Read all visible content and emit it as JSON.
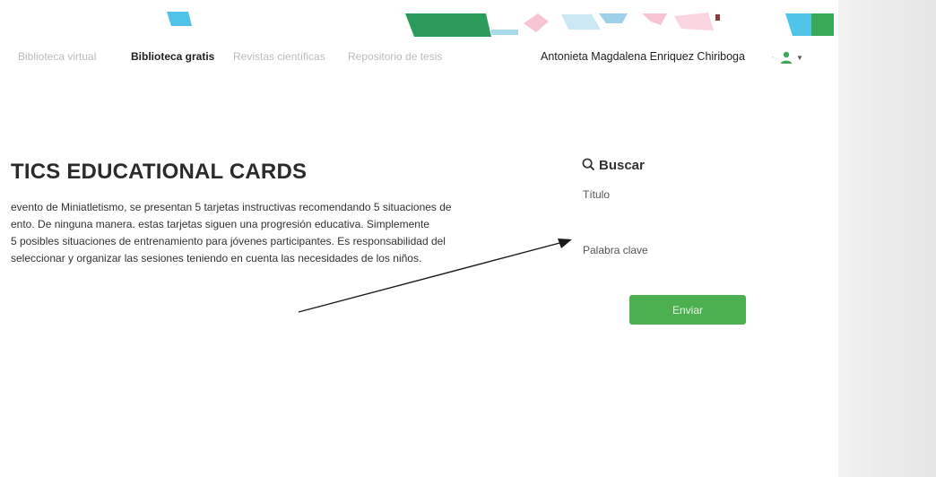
{
  "nav": {
    "items": [
      {
        "label": "Biblioteca virtual",
        "active": false
      },
      {
        "label": "Biblioteca gratis",
        "active": true
      },
      {
        "label": "Revistas científicas",
        "active": false
      },
      {
        "label": "Repositorio de tesis",
        "active": false
      }
    ],
    "user_name": "Antonieta Magdalena Enriquez Chiriboga",
    "user_icon": "user-icon",
    "caret_icon": "caret-down-icon"
  },
  "main": {
    "title": "TICS EDUCATIONAL CARDS",
    "description_lines": [
      "evento de Miniatletismo, se presentan 5 tarjetas instructivas recomendando 5 situaciones de",
      "ento. De ninguna manera. estas tarjetas siguen una progresión educativa. Simplemente",
      " 5 posibles situaciones de entrenamiento para jóvenes participantes. Es responsabilidad del",
      "seleccionar y organizar las sesiones teniendo en cuenta las necesidades de los niños."
    ]
  },
  "search": {
    "title": "Buscar",
    "icon": "search-icon",
    "fields": [
      {
        "label": "Título",
        "value": ""
      },
      {
        "label": "Palabra clave",
        "value": ""
      }
    ],
    "submit_label": "Enviar"
  },
  "colors": {
    "accent_green": "#4cb050",
    "banner_blue": "#4fc3e8",
    "banner_green": "#3aa856",
    "banner_pink": "#f4b6c6"
  }
}
